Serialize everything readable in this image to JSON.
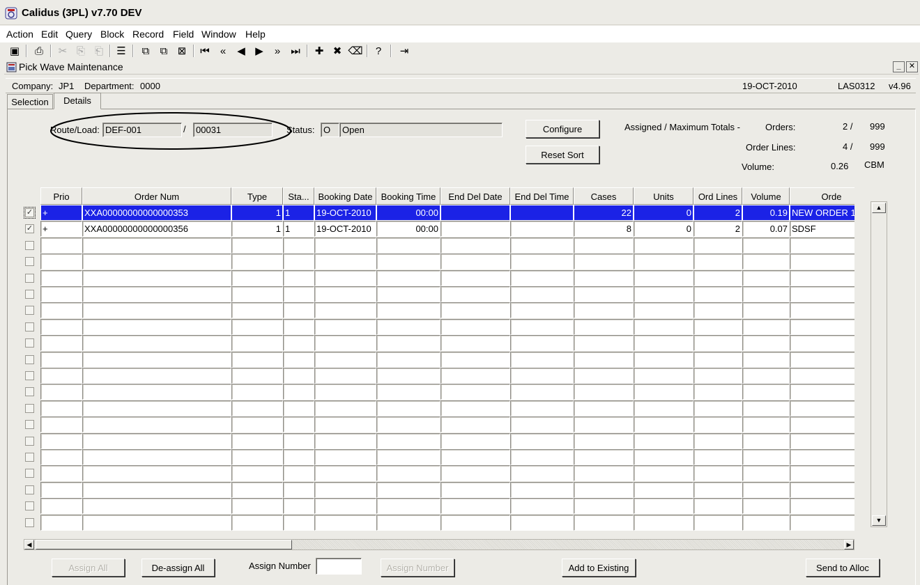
{
  "app": {
    "title": "Calidus (3PL) v7.70 DEV"
  },
  "menu": [
    "Action",
    "Edit",
    "Query",
    "Block",
    "Record",
    "Field",
    "Window",
    "Help"
  ],
  "toolbar": {
    "icons": [
      "save-icon",
      "print-icon",
      "cut-icon",
      "copy-icon",
      "paste-icon",
      "list-icon",
      "query-icon",
      "execute-query-icon",
      "cancel-query-icon",
      "first-record-icon",
      "previous-block-icon",
      "previous-record-icon",
      "next-record-icon",
      "next-block-icon",
      "last-record-icon",
      "insert-record-icon",
      "delete-record-icon",
      "clear-icon",
      "help-icon",
      "exit-icon"
    ],
    "glyphs": [
      "▣",
      "⎙",
      "✂",
      "⎘",
      "⎗",
      "☰",
      "⧉",
      "⧉",
      "⊠",
      "⏮",
      "«",
      "◀",
      "▶",
      "»",
      "⏭",
      "✚",
      "✖",
      "⌫",
      "?",
      "⇥"
    ]
  },
  "form": {
    "title": "Pick Wave Maintenance",
    "minimize_label": "_",
    "close_label": "✕"
  },
  "header": {
    "company_label": "Company:",
    "company_value": "JP1",
    "department_label": "Department:",
    "department_value": "0000",
    "date": "19-OCT-2010",
    "form_code": "LAS0312",
    "version": "v4.96"
  },
  "tabs": {
    "selection": "Selection",
    "details": "Details"
  },
  "details": {
    "route_load_label": "Route/Load:",
    "route_value": "DEF-001",
    "separator": "/",
    "load_value": "00031",
    "status_label": "Status:",
    "status_code": "O",
    "status_text": "Open",
    "configure_button": "Configure",
    "reset_sort_button": "Reset Sort",
    "totals_label": "Assigned / Maximum Totals -",
    "orders_label": "Orders:",
    "orders_assigned": "2 /",
    "orders_max": "999",
    "order_lines_label": "Order Lines:",
    "order_lines_assigned": "4 /",
    "order_lines_max": "999",
    "volume_label": "Volume:",
    "volume_value": "0.26",
    "volume_unit": "CBM"
  },
  "grid": {
    "columns": [
      "Prio",
      "Order Num",
      "Type",
      "Sta...",
      "Booking Date",
      "Booking Time",
      "End Del Date",
      "End Del Time",
      "Cases",
      "Units",
      "Ord Lines",
      "Volume",
      "Orde"
    ],
    "rows": [
      {
        "checked": true,
        "selected": true,
        "cells": [
          "+",
          "XXA00000000000000353",
          "1",
          "1",
          "19-OCT-2010",
          "00:00",
          "",
          "",
          "22",
          "0",
          "2",
          "0.19",
          "NEW ORDER 1"
        ]
      },
      {
        "checked": true,
        "selected": false,
        "cells": [
          "+",
          "XXA00000000000000356",
          "1",
          "1",
          "19-OCT-2010",
          "00:00",
          "",
          "",
          "8",
          "0",
          "2",
          "0.07",
          "SDSF"
        ]
      }
    ],
    "empty_rows": 18,
    "check_glyph": "✓"
  },
  "footer": {
    "assign_all": "Assign All",
    "deassign_all": "De-assign All",
    "assign_number_label": "Assign Number",
    "assign_number_value": "",
    "assign_number_button": "Assign Number",
    "add_to_existing": "Add to Existing",
    "send_to_alloc": "Send to Alloc"
  },
  "colors": {
    "selection": "#1b22e6",
    "background": "#ecebe6"
  }
}
